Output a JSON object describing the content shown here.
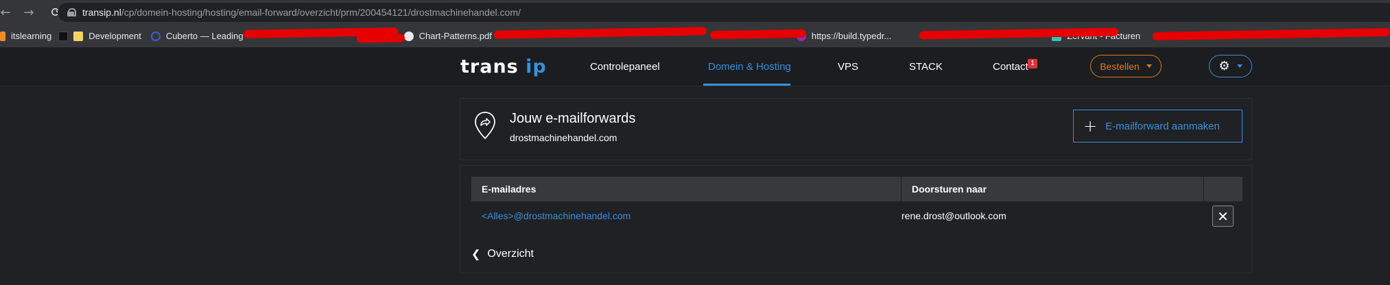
{
  "browser": {
    "back_glyph": "←",
    "forward_glyph": "→",
    "reload_glyph": "⟳",
    "url_host": "transip.nl",
    "url_path": "/cp/domein-hosting/hosting/email-forward/overzicht/prm/200454121/drostmachinehandel.com/"
  },
  "bookmarks": [
    {
      "label": "itslearning",
      "icon": "itslearning-icon",
      "color": "#f28c28"
    },
    {
      "label": "Development",
      "icon": "folder-icon",
      "color": "#f6d365"
    },
    {
      "label": "Cuberto — Leading",
      "icon": "cuberto-icon",
      "color": "#3b5bdb"
    },
    {
      "label": "Chart-Patterns.pdf",
      "icon": "globe-icon",
      "color": "#e8eaed"
    },
    {
      "label": "https://build.typedr...",
      "icon": "globe-icon",
      "color": "#9c27b0"
    },
    {
      "label": "Zervant - Facturen",
      "icon": "zervant-icon",
      "color": "#2ec4b6"
    }
  ],
  "site": {
    "logo_a": "trans",
    "logo_b": "ip",
    "nav": [
      "Controlepaneel",
      "Domein & Hosting",
      "VPS",
      "STACK",
      "Contact"
    ],
    "contact_badge": "1",
    "bestellen": "Bestellen",
    "account_icon": "gear-icon",
    "accent": "#3a8fde",
    "order_color": "#e07a1f"
  },
  "header_panel": {
    "title": "Jouw e-mailforwards",
    "domain": "drostmachinehandel.com",
    "create_label": "E-mailforward aanmaken"
  },
  "table": {
    "columns": [
      "E-mailadres",
      "Doorsturen naar"
    ],
    "rows": [
      {
        "email": "<Alles>@drostmachinehandel.com",
        "forward_to": "rene.drost@outlook.com"
      }
    ],
    "back_label": "Overzicht"
  }
}
